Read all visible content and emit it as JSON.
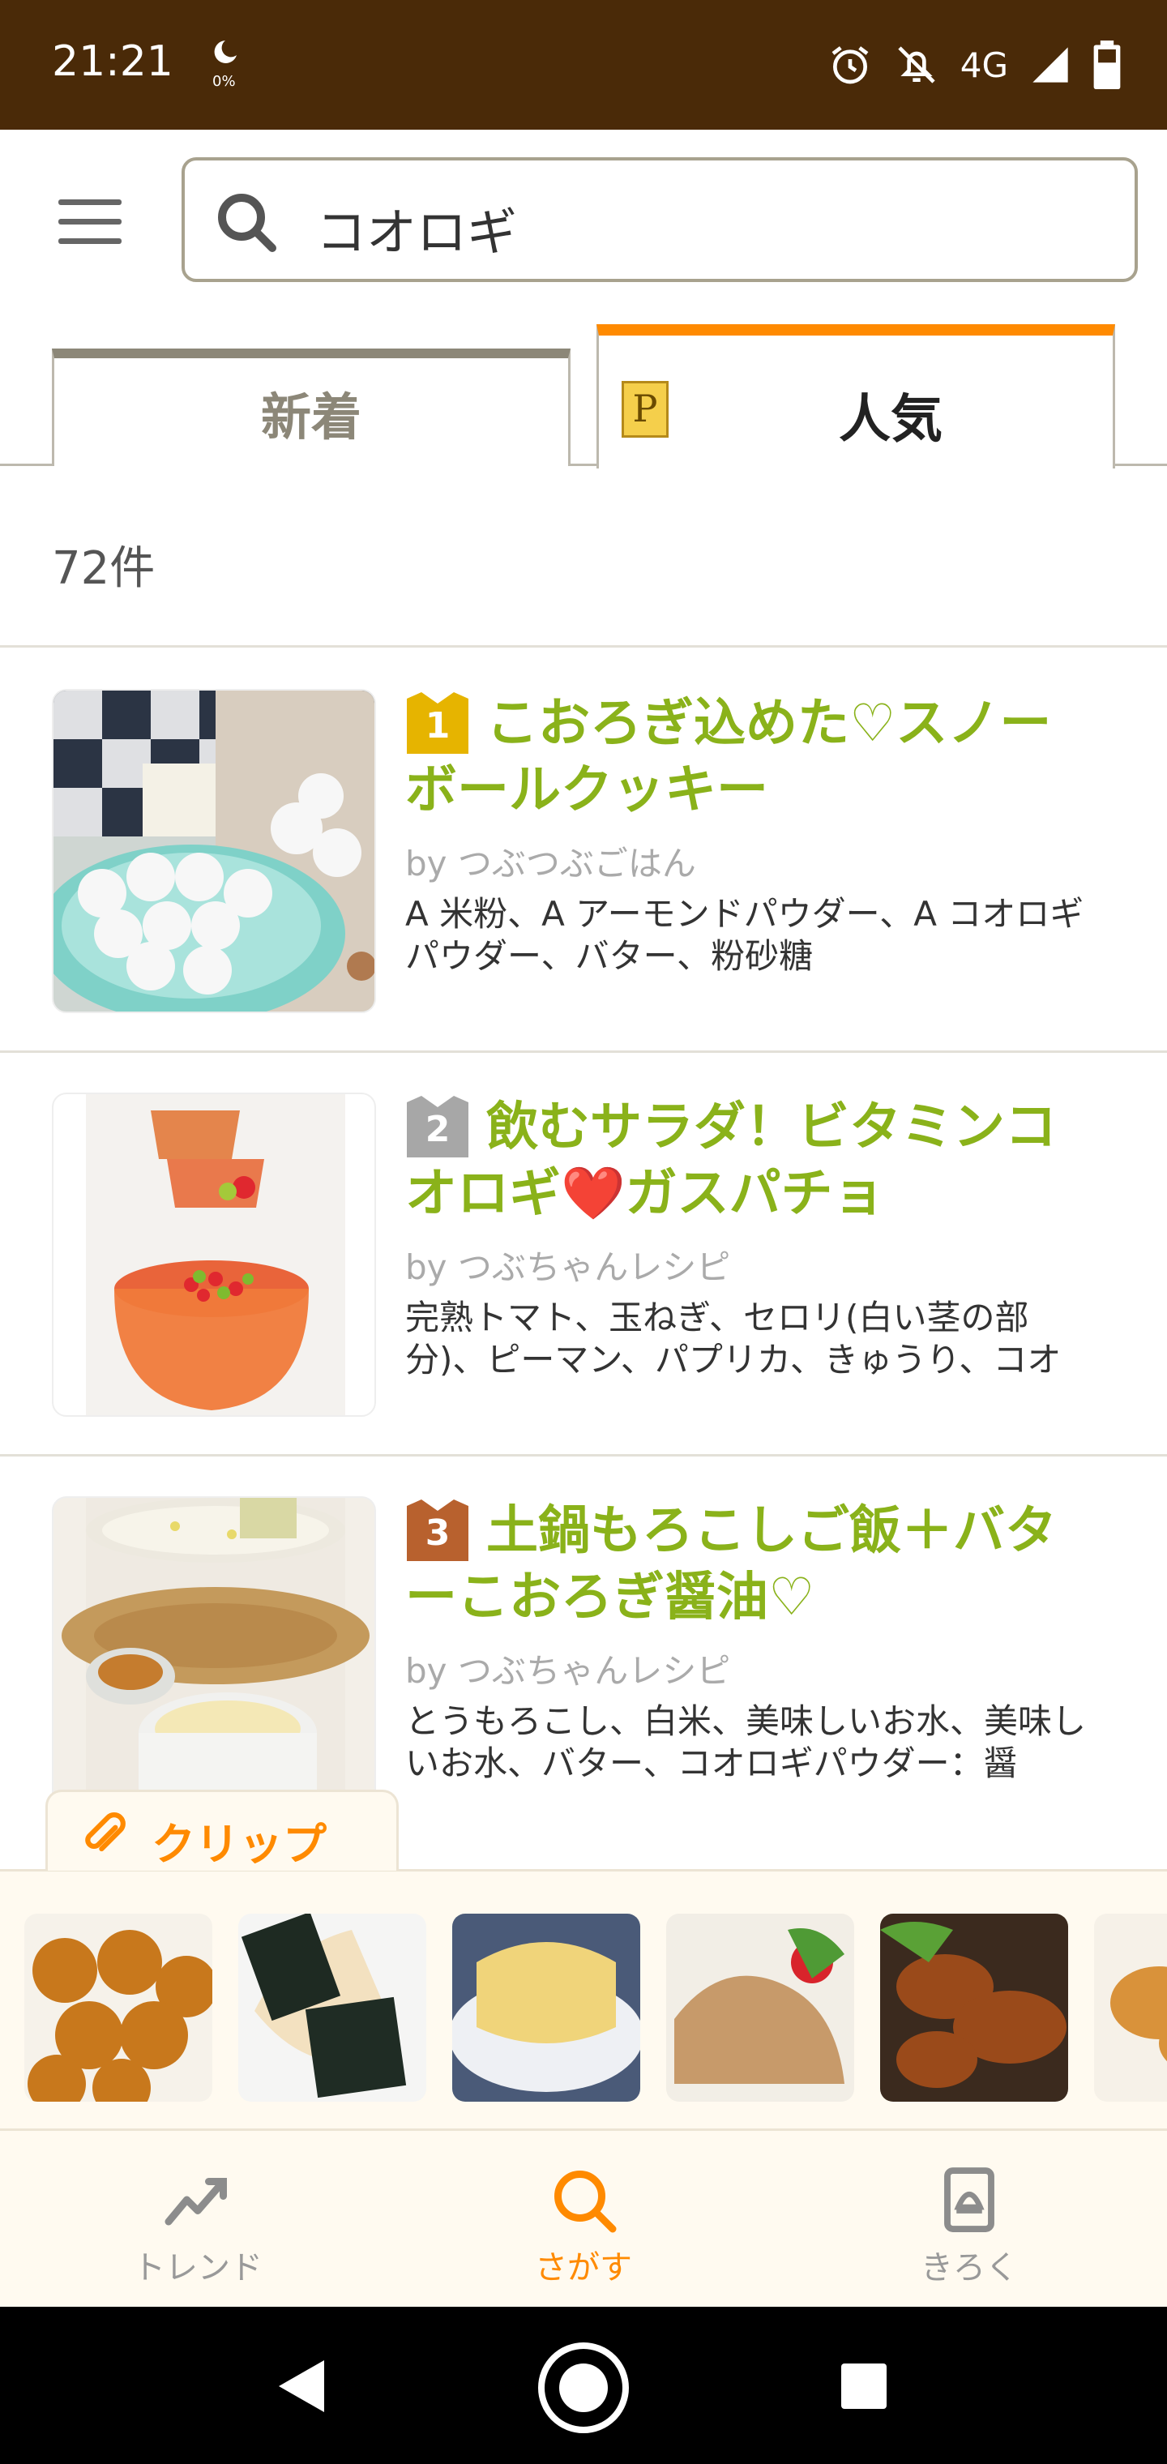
{
  "status_bar": {
    "time": "21:21",
    "battery_saver": "0%",
    "network": "4G",
    "icons": [
      "alarm-icon",
      "notifications-off-icon",
      "signal-icon",
      "battery-icon"
    ]
  },
  "search": {
    "query": "コオロギ",
    "menu_icon": "hamburger-icon",
    "search_icon": "search-icon"
  },
  "tabs": [
    {
      "label": "新着",
      "active": false
    },
    {
      "label": "人気",
      "active": true,
      "icon": "premium-p-icon"
    }
  ],
  "result_count": "72件",
  "recipes": [
    {
      "rank": "1",
      "rank_color": "#e6b400",
      "title": "こおろぎ込めた♡スノーボールクッキー",
      "author": "by つぶつぶごはん",
      "ingredients": "A 米粉、A アーモンドパウダー、A コオロギパウダー、バター、粉砂糖"
    },
    {
      "rank": "2",
      "rank_color": "#a7a7a7",
      "title": "飲むサラダ！ビタミンコオロギ❤️ガスパチョ",
      "author": "by つぶちゃんレシピ",
      "ingredients": "完熟トマト、玉ねぎ、セロリ(白い茎の部分)、ピーマン、パプリカ、きゅうり、コオ"
    },
    {
      "rank": "3",
      "rank_color": "#b8612e",
      "title": "土鍋もろこしご飯＋バターこおろぎ醤油♡",
      "author": "by つぶちゃんレシピ",
      "ingredients": "とうもろこし、白米、美味しいお水、美味しいお水、バター、コオロギパウダー：醤"
    }
  ],
  "clip": {
    "label": "クリップ",
    "icon": "paperclip-icon",
    "thumbnails": [
      "croquette-balls",
      "onigiri-nori",
      "steamed-cake",
      "pork-ginger-stirfry",
      "glazed-chicken",
      "fried-chicken"
    ]
  },
  "bottom_nav": [
    {
      "label": "トレンド",
      "icon": "trend-icon",
      "active": false
    },
    {
      "label": "さがす",
      "icon": "search-icon",
      "active": true
    },
    {
      "label": "きろく",
      "icon": "record-icon",
      "active": false
    }
  ],
  "colors": {
    "status_bar": "#4a2a08",
    "accent": "#ff8a00",
    "title_green": "#8ab21a"
  }
}
